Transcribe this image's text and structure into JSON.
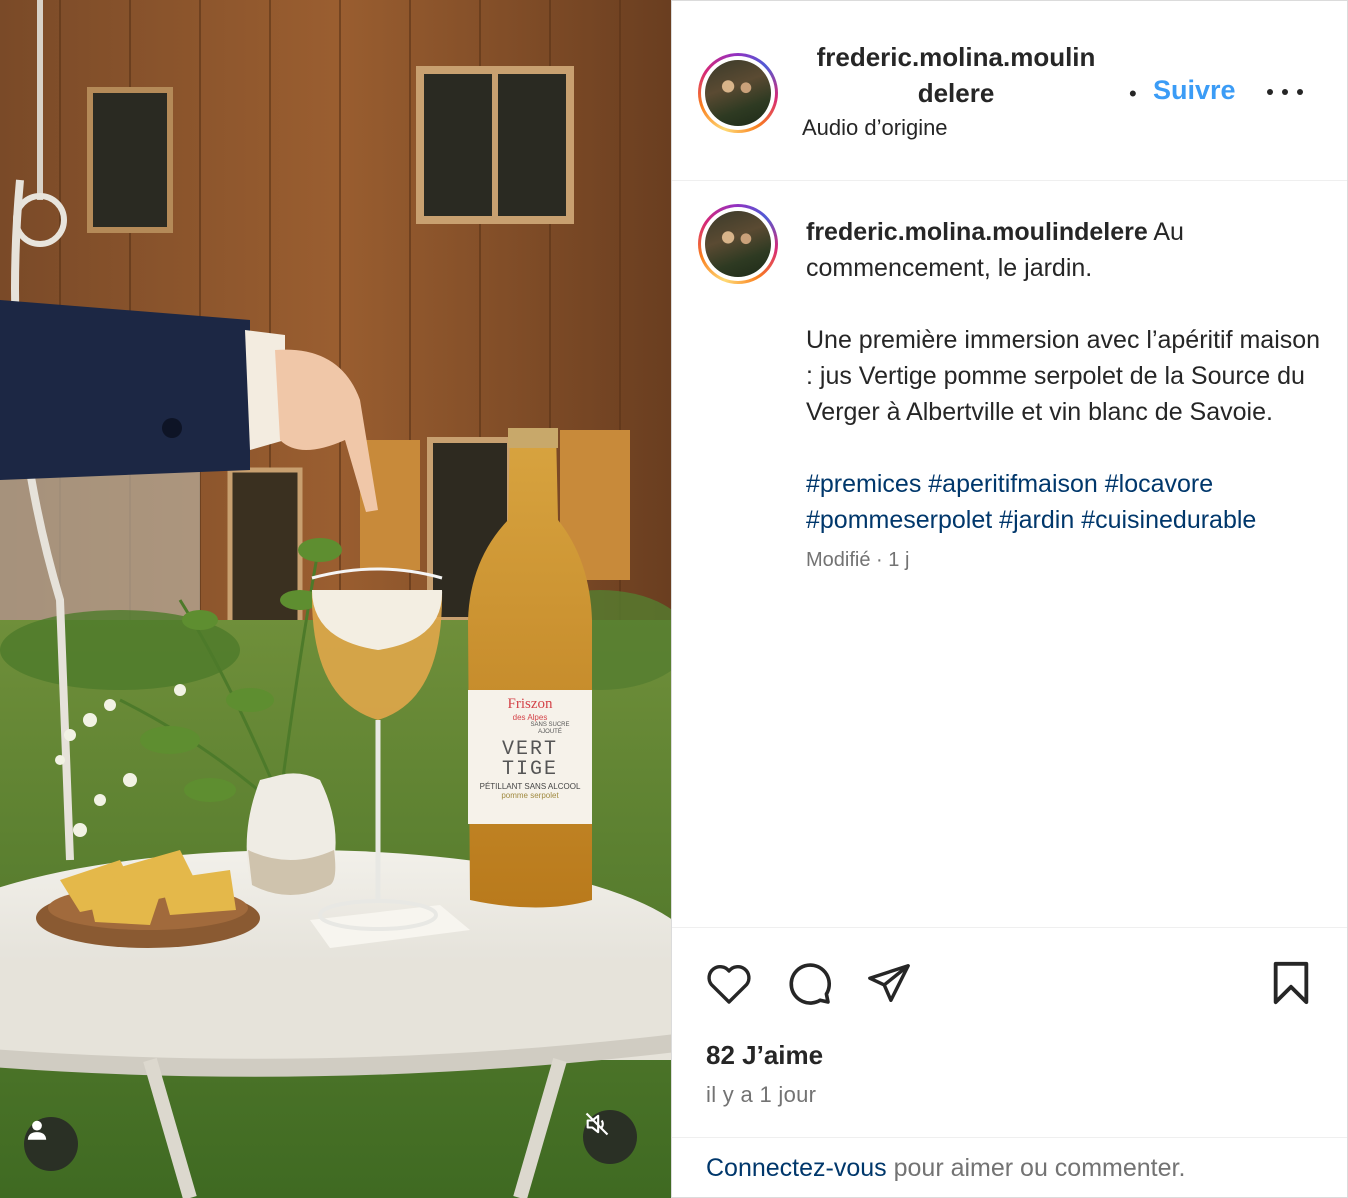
{
  "post": {
    "username": "frederic.molina.moulindelere",
    "username_line1": "frederic.molina.moulin",
    "username_line2": "delere",
    "audio": "Audio d’origine",
    "separator": "•",
    "follow_label": "Suivre",
    "caption_intro": "Au commencement, le jardin.",
    "caption_body": "Une première immersion avec l’apéritif maison : jus Vertige pomme serpolet de la Source du Verger à Albertville et vin blanc de Savoie.",
    "hashtags": [
      "#premices",
      "#aperitifmaison",
      "#locavore",
      "#pommeserpolet",
      "#jardin",
      "#cuisinedurable"
    ],
    "edited": "Modifié",
    "edited_sep": " · ",
    "edited_age": "1 j",
    "likes": "82 J’aime",
    "time_ago": "il y a 1 jour",
    "login_link": "Connectez-vous",
    "login_rest": " pour aimer ou commenter."
  },
  "media": {
    "bottle_label_brand": "Friszon",
    "bottle_label_sub": "des Alpes",
    "bottle_label_name_1": "VERT",
    "bottle_label_name_2": "TIGE",
    "bottle_label_desc": "PÉTILLANT SANS ALCOOL",
    "bottle_label_flavor": "pomme serpolet",
    "bottle_label_badge": "SANS SUCRE AJOUTÉ"
  },
  "icons": {
    "like": "heart-icon",
    "comment": "comment-icon",
    "share": "paper-plane-icon",
    "save": "bookmark-icon",
    "more": "more-horizontal-icon",
    "user": "user-icon",
    "mute": "speaker-muted-icon"
  },
  "colors": {
    "follow": "#3b9cf6",
    "hashtag": "#00376b",
    "muted_text": "#737373"
  }
}
